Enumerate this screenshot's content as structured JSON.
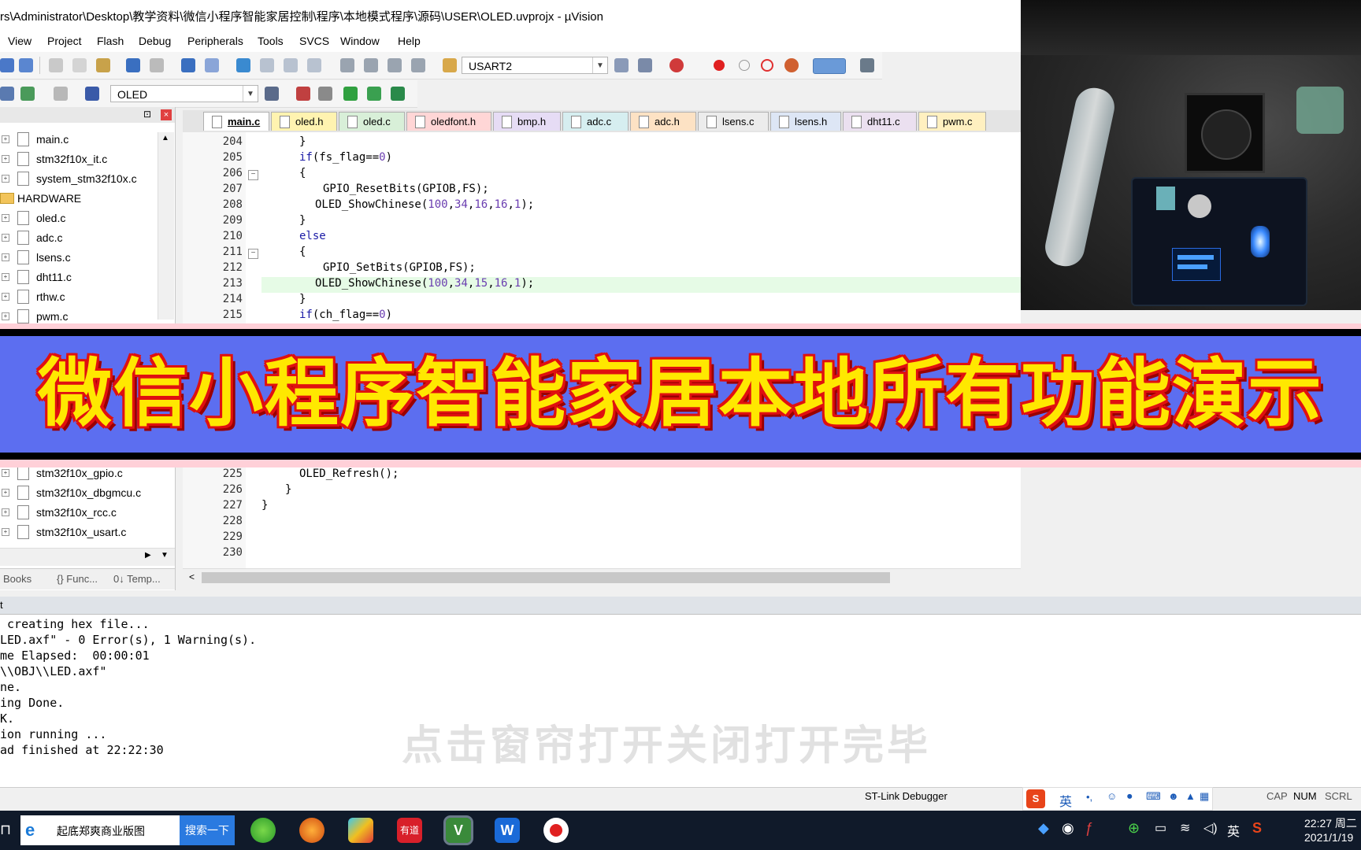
{
  "window": {
    "title": "rs\\Administrator\\Desktop\\教学资料\\微信小程序智能家居控制\\程序\\本地模式程序\\源码\\USER\\OLED.uvprojx - µVision"
  },
  "menu": [
    "View",
    "Project",
    "Flash",
    "Debug",
    "Peripherals",
    "Tools",
    "SVCS",
    "Window",
    "Help"
  ],
  "toolbar": {
    "uart_combo": "USART2",
    "target_combo": "OLED"
  },
  "project": {
    "items_top": [
      {
        "type": "file",
        "label": "main.c"
      },
      {
        "type": "file",
        "label": "stm32f10x_it.c"
      },
      {
        "type": "file",
        "label": "system_stm32f10x.c"
      },
      {
        "type": "folder",
        "label": "HARDWARE"
      },
      {
        "type": "file",
        "label": "oled.c"
      },
      {
        "type": "file",
        "label": "adc.c"
      },
      {
        "type": "file",
        "label": "lsens.c"
      },
      {
        "type": "file",
        "label": "dht11.c"
      },
      {
        "type": "file",
        "label": "rthw.c"
      },
      {
        "type": "file",
        "label": "pwm.c"
      }
    ],
    "items_bottom": [
      {
        "label": "stm32f10x_gpio.c"
      },
      {
        "label": "stm32f10x_dbgmcu.c"
      },
      {
        "label": "stm32f10x_rcc.c"
      },
      {
        "label": "stm32f10x_usart.c"
      }
    ],
    "tabs": [
      "Books",
      "{} Func...",
      "0↓ Temp..."
    ]
  },
  "editor_tabs": [
    {
      "label": "main.c",
      "color": "#ffffff",
      "active": true
    },
    {
      "label": "oled.h",
      "color": "#fff3b0"
    },
    {
      "label": "oled.c",
      "color": "#d8efd8"
    },
    {
      "label": "oledfont.h",
      "color": "#ffd6d6"
    },
    {
      "label": "bmp.h",
      "color": "#e6dcf5"
    },
    {
      "label": "adc.c",
      "color": "#d6eef0"
    },
    {
      "label": "adc.h",
      "color": "#fde2c4"
    },
    {
      "label": "lsens.c",
      "color": "#ececec"
    },
    {
      "label": "lsens.h",
      "color": "#dde6f5"
    },
    {
      "label": "dht11.c",
      "color": "#ebe0f0"
    },
    {
      "label": "pwm.c",
      "color": "#fff0c0"
    }
  ],
  "code_top": [
    {
      "ln": "204",
      "text": "}"
    },
    {
      "ln": "205",
      "text": "if(fs_flag==0)"
    },
    {
      "ln": "206",
      "text": "{"
    },
    {
      "ln": "207",
      "text": "GPIO_ResetBits(GPIOB,FS);"
    },
    {
      "ln": "208",
      "text": "OLED_ShowChinese(100,34,16,16,1);"
    },
    {
      "ln": "209",
      "text": "}"
    },
    {
      "ln": "210",
      "text": "else"
    },
    {
      "ln": "211",
      "text": "{"
    },
    {
      "ln": "212",
      "text": "GPIO_SetBits(GPIOB,FS);"
    },
    {
      "ln": "213",
      "text": "OLED_ShowChinese(100,34,15,16,1);"
    },
    {
      "ln": "214",
      "text": "}"
    },
    {
      "ln": "215",
      "text": "if(ch_flag==0)"
    }
  ],
  "code_bottom": [
    {
      "ln": "225",
      "text": "OLED_Refresh();"
    },
    {
      "ln": "226",
      "text": "}"
    },
    {
      "ln": "227",
      "text": "}"
    },
    {
      "ln": "228",
      "text": ""
    },
    {
      "ln": "229",
      "text": ""
    },
    {
      "ln": "230",
      "text": ""
    }
  ],
  "output": {
    "header": "t",
    "lines": [
      " creating hex file...",
      "LED.axf\" - 0 Error(s), 1 Warning(s).",
      "me Elapsed:  00:00:01",
      "\\\\OBJ\\\\LED.axf\"",
      "ne.",
      "ing Done.",
      "K.",
      "ion running ...",
      "ad finished at 22:22:30"
    ]
  },
  "status": {
    "debugger": "ST-Link Debugger",
    "cap": "CAP",
    "num": "NUM",
    "scrl": "SCRL"
  },
  "banner": {
    "text": "微信小程序智能家居本地所有功能演示"
  },
  "subtitle": "点击窗帘打开关闭打开完毕",
  "taskbar": {
    "search_text": "起底郑爽商业版图",
    "search_button": "搜索一下",
    "ime_lang": "英",
    "tray_lang": "英",
    "time": "22:27 周二",
    "date": "2021/1/19"
  }
}
